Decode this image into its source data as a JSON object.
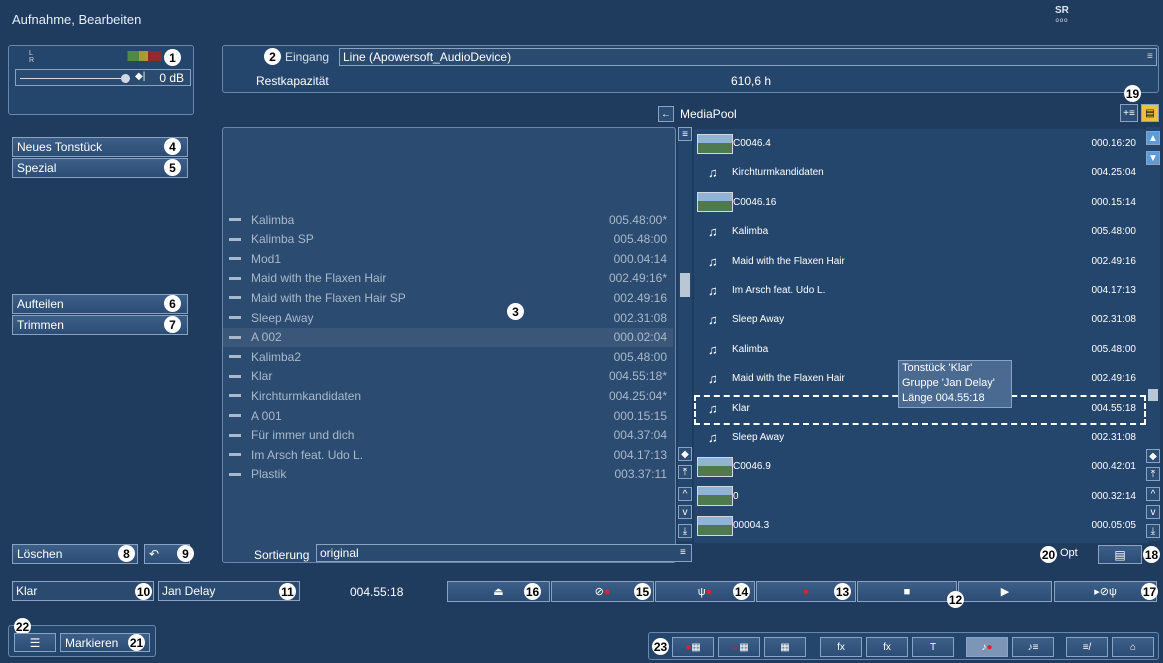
{
  "window": {
    "title": "Aufnahme, Bearbeiten",
    "logo_top": "SR",
    "logo_bottom": "ooo"
  },
  "meter": {
    "level_label": "0 dB",
    "channel_l": "L",
    "channel_r": "R"
  },
  "input": {
    "label": "Eingang",
    "value": "Line (Apowersoft_AudioDevice)",
    "capacity_label": "Restkapazität",
    "capacity_value": "610,6 h"
  },
  "mediapool": {
    "label": "MediaPool"
  },
  "left_buttons": {
    "new_track": "Neues Tonstück",
    "special": "Spezial",
    "split": "Aufteilen",
    "trim": "Trimmen",
    "delete": "Löschen"
  },
  "left_list": [
    {
      "name": "Kalimba",
      "duration": "005.48:00*"
    },
    {
      "name": "Kalimba SP",
      "duration": "005.48:00"
    },
    {
      "name": "Mod1",
      "duration": "000.04:14"
    },
    {
      "name": "Maid with the Flaxen Hair",
      "duration": "002.49:16*"
    },
    {
      "name": "Maid with the Flaxen Hair SP",
      "duration": "002.49:16"
    },
    {
      "name": "Sleep Away",
      "duration": "002.31:08"
    },
    {
      "name": "A 002",
      "duration": "000.02:04"
    },
    {
      "name": "Kalimba2",
      "duration": "005.48:00"
    },
    {
      "name": "Klar",
      "duration": "004.55:18*"
    },
    {
      "name": "Kirchturmkandidaten",
      "duration": "004.25:04*"
    },
    {
      "name": "A 001",
      "duration": "000.15:15"
    },
    {
      "name": "Für immer und dich",
      "duration": "004.37:04"
    },
    {
      "name": "Im Arsch feat. Udo L.",
      "duration": "004.17:13"
    },
    {
      "name": "Plastik",
      "duration": "003.37:11"
    }
  ],
  "sort": {
    "label": "Sortierung",
    "value": "original"
  },
  "right_list": [
    {
      "kind": "video",
      "name": "C0046.4",
      "duration": "000.16:20"
    },
    {
      "kind": "audio",
      "name": "Kirchturmkandidaten",
      "duration": "004.25:04"
    },
    {
      "kind": "video",
      "name": "C0046.16",
      "duration": "000.15:14"
    },
    {
      "kind": "audio",
      "name": "Kalimba",
      "duration": "005.48:00"
    },
    {
      "kind": "audio",
      "name": "Maid with the Flaxen Hair",
      "duration": "002.49:16"
    },
    {
      "kind": "audio",
      "name": "Im Arsch feat. Udo L.",
      "duration": "004.17:13"
    },
    {
      "kind": "audio",
      "name": "Sleep Away",
      "duration": "002.31:08"
    },
    {
      "kind": "audio",
      "name": "Kalimba",
      "duration": "005.48:00"
    },
    {
      "kind": "audio",
      "name": "Maid with the Flaxen Hair",
      "duration": "002.49:16"
    },
    {
      "kind": "audio",
      "name": "Klar",
      "duration": "004.55:18"
    },
    {
      "kind": "audio",
      "name": "Sleep Away",
      "duration": "002.31:08"
    },
    {
      "kind": "video",
      "name": "C0046.9",
      "duration": "000.42:01"
    },
    {
      "kind": "video",
      "name": "0",
      "duration": "000.32:14"
    },
    {
      "kind": "video",
      "name": "00004.3",
      "duration": "000.05:05"
    }
  ],
  "tooltip": {
    "line1": "Tonstück 'Klar'",
    "line2": "Gruppe 'Jan Delay'",
    "line3": "Länge 004.55:18"
  },
  "opt_label": "Opt",
  "track": {
    "name": "Klar",
    "group": "Jan Delay",
    "duration": "004.55:18"
  },
  "mark_label": "Markieren",
  "badges": [
    "1",
    "2",
    "3",
    "4",
    "5",
    "6",
    "7",
    "8",
    "9",
    "10",
    "11",
    "12",
    "13",
    "14",
    "15",
    "16",
    "17",
    "18",
    "19",
    "20",
    "21",
    "22",
    "23"
  ],
  "transport_icons": [
    "eject-icon",
    "no-record-icon",
    "usb-record-icon",
    "record-icon",
    "stop-icon",
    "play-icon",
    "play-no-usb-icon"
  ],
  "nav_icons": [
    "record-menu-icon",
    "import-menu-icon",
    "storyboard-icon",
    "fx-icon",
    "fx-icon",
    "title-icon",
    "audio-record-icon",
    "audio-list-icon",
    "edit-icon",
    "home-icon"
  ],
  "colors": {
    "background": "#1f3b5e",
    "panel": "#25466c",
    "record": "#e22222",
    "selected_row": "#3a5678"
  }
}
